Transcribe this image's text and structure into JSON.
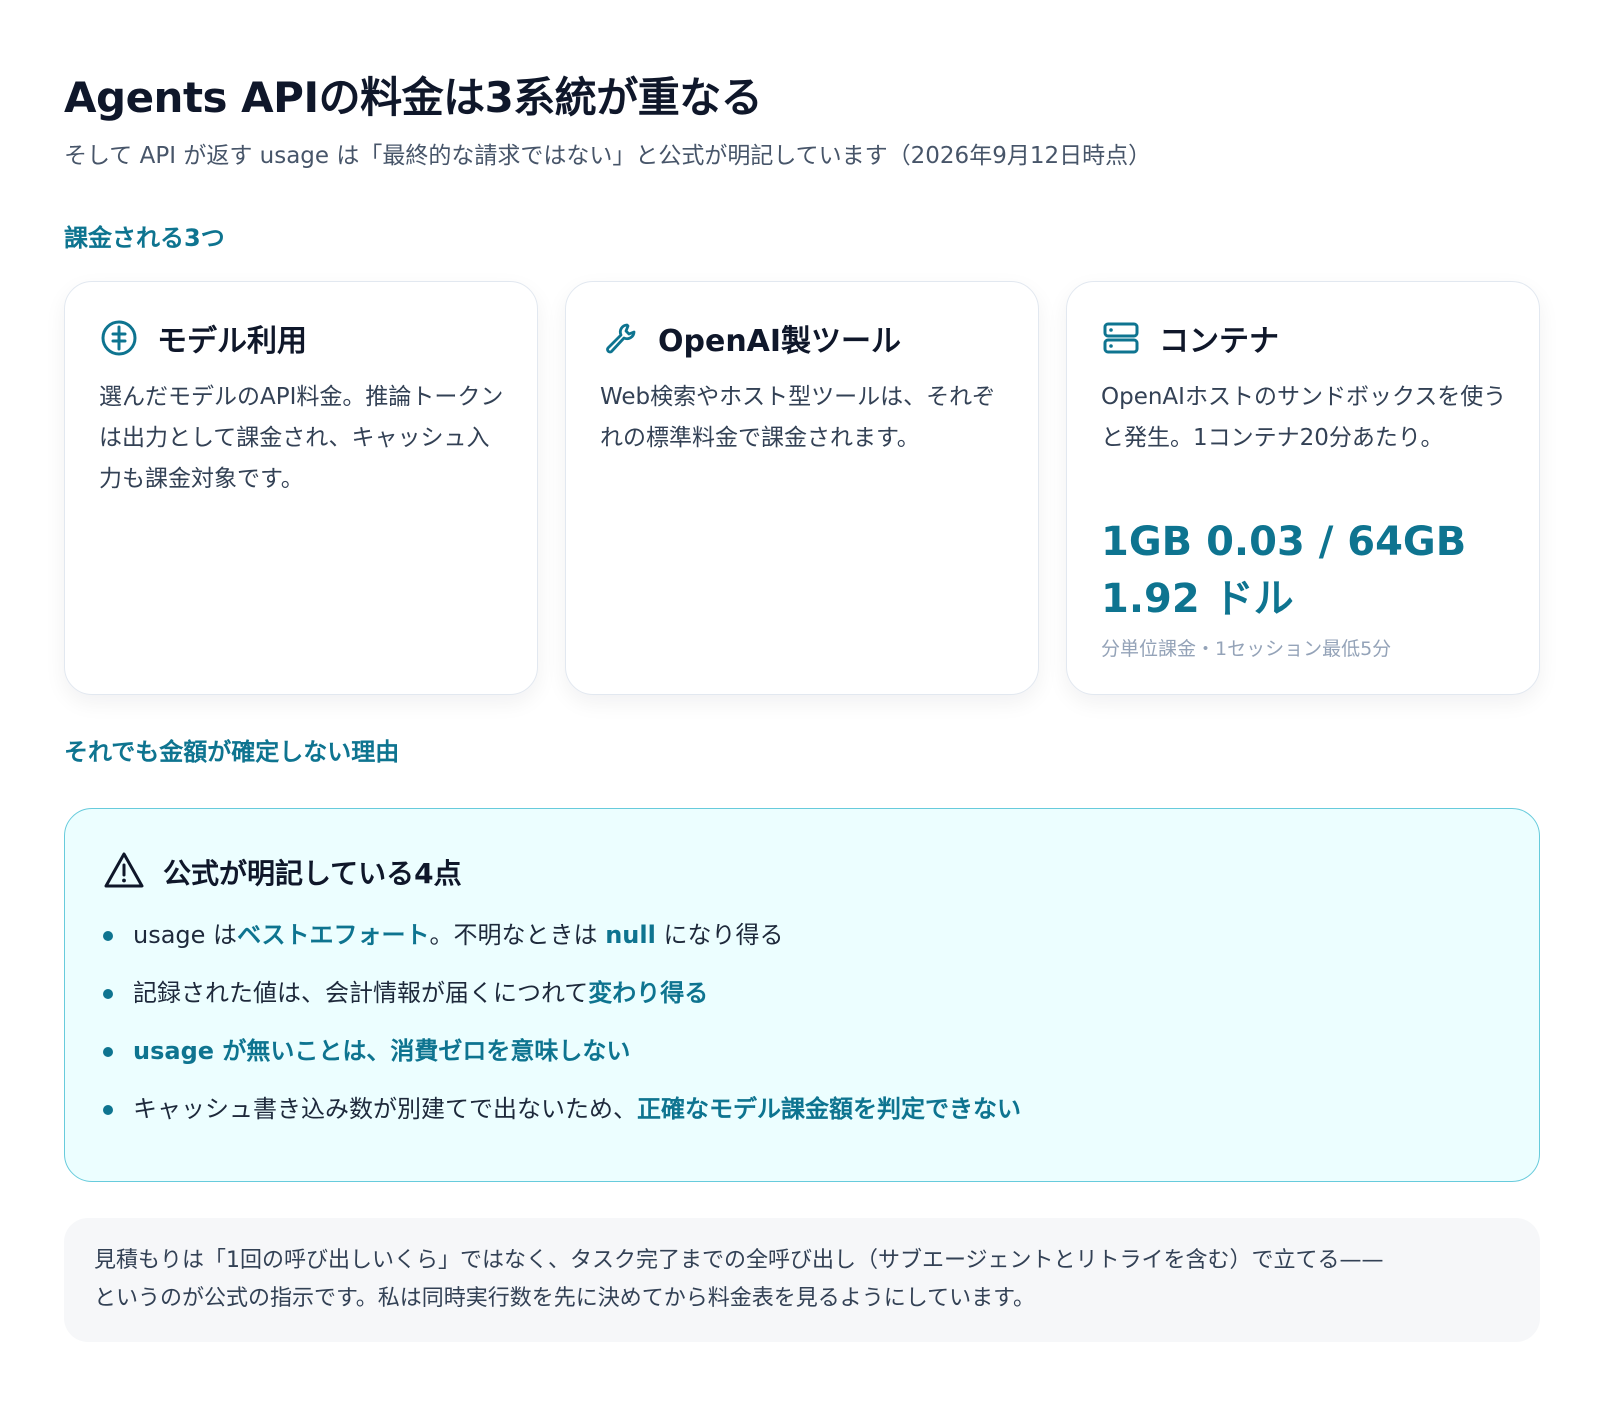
{
  "header": {
    "title": "Agents APIの料金は3系統が重なる",
    "subtitle": "そして API が返す usage は「最終的な請求ではない」と公式が明記しています（2026年9月12日時点）"
  },
  "billing_section": {
    "label": "課金される3つ",
    "cards": [
      {
        "icon": "dollar-circle-icon",
        "title": "モデル利用",
        "body": "選んだモデルのAPI料金。推論トークンは出力として課金され、キャッシュ入力も課金対象です。"
      },
      {
        "icon": "wrench-icon",
        "title": "OpenAI製ツール",
        "body": "Web検索やホスト型ツールは、それぞれの標準料金で課金されます。"
      },
      {
        "icon": "server-icon",
        "title": "コンテナ",
        "body": "OpenAIホストのサンドボックスを使うと発生。1コンテナ20分あたり。",
        "price": "1GB 0.03 / 64GB 1.92 ドル",
        "note": "分単位課金・1セッション最低5分"
      }
    ]
  },
  "uncertainty_section": {
    "label": "それでも金額が確定しない理由",
    "notice": {
      "icon": "warning-triangle-icon",
      "title": "公式が明記している4点",
      "items": [
        {
          "parts": [
            {
              "text": "usage は",
              "highlight": false
            },
            {
              "text": "ベストエフォート",
              "highlight": true
            },
            {
              "text": "。不明なときは ",
              "highlight": false
            },
            {
              "text": "null",
              "highlight": true
            },
            {
              "text": " になり得る",
              "highlight": false
            }
          ]
        },
        {
          "parts": [
            {
              "text": "記録された値は、会計情報が届くにつれて",
              "highlight": false
            },
            {
              "text": "変わり得る",
              "highlight": true
            }
          ]
        },
        {
          "parts": [
            {
              "text": "usage が無いことは、消費ゼロを意味しない",
              "highlight": true
            }
          ]
        },
        {
          "parts": [
            {
              "text": "キャッシュ書き込み数が別建てで出ないため、",
              "highlight": false
            },
            {
              "text": "正確なモデル課金額を判定できない",
              "highlight": true
            }
          ]
        }
      ]
    }
  },
  "footer": {
    "line1": "見積もりは「1回の呼び出しいくら」ではなく、タスク完了までの全呼び出し（サブエージェントとリトライを含む）で立てる——",
    "line2": "というのが公式の指示です。私は同時実行数を先に決めてから料金表を見るようにしています。"
  },
  "colors": {
    "accent": "#0e7490",
    "notice_bg": "#ecfeff",
    "notice_border": "#67cbdc",
    "text": "#0f172a"
  }
}
